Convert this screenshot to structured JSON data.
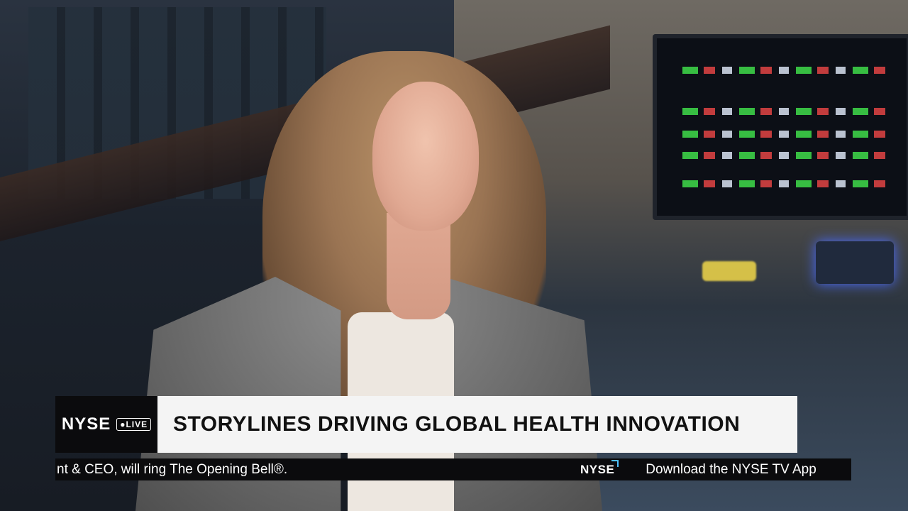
{
  "lower_third": {
    "brand": "NYSE",
    "live_badge": "LIVE",
    "headline": "STORYLINES DRIVING GLOBAL HEALTH INNOVATION"
  },
  "ticker": {
    "crawl_text": "nt & CEO, will ring The Opening Bell®.",
    "logo": "NYSE",
    "promo_text": "Download the NYSE TV App"
  },
  "colors": {
    "ticker_bg": "#0b0b0d",
    "headline_bg": "#f4f4f4",
    "accent": "#4ec0ff"
  }
}
